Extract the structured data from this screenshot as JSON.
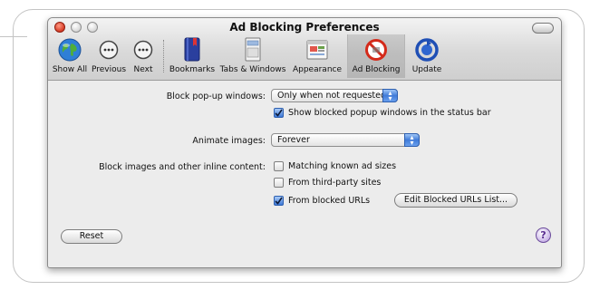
{
  "window": {
    "title": "Ad Blocking Preferences"
  },
  "toolbar": {
    "items": [
      {
        "label": "Show All",
        "icon": "globe-icon"
      },
      {
        "label": "Previous",
        "icon": "previous-icon"
      },
      {
        "label": "Next",
        "icon": "next-icon"
      },
      {
        "label": "Bookmarks",
        "icon": "bookmarks-icon"
      },
      {
        "label": "Tabs & Windows",
        "icon": "tabs-windows-icon"
      },
      {
        "label": "Appearance",
        "icon": "appearance-icon"
      },
      {
        "label": "Ad Blocking",
        "icon": "no-ads-icon",
        "selected": true
      },
      {
        "label": "Update",
        "icon": "update-icon"
      }
    ]
  },
  "popups": {
    "label": "Block pop-up windows:",
    "value": "Only when not requested",
    "show_blocked": {
      "label": "Show blocked popup windows in the status bar",
      "checked": true
    }
  },
  "animate": {
    "label": "Animate images:",
    "value": "Forever"
  },
  "inline": {
    "label": "Block images and other inline content:",
    "options": [
      {
        "label": "Matching known ad sizes",
        "checked": false
      },
      {
        "label": "From third-party sites",
        "checked": false
      },
      {
        "label": "From blocked URLs",
        "checked": true
      }
    ],
    "edit_button": "Edit Blocked URLs List..."
  },
  "reset_button": "Reset",
  "help_button": "?",
  "colors": {
    "accent": "#3f7ad8",
    "window_bg": "#ececec"
  }
}
